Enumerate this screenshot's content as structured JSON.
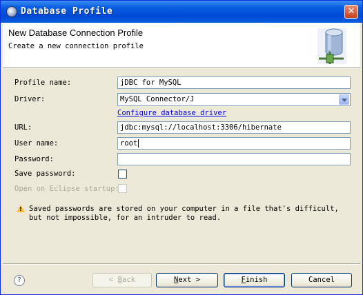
{
  "window": {
    "title": "Database Profile"
  },
  "header": {
    "title": "New Database Connection Profile",
    "description": "Create a new connection profile"
  },
  "form": {
    "profile_name": {
      "label": "Profile name:",
      "value": "jDBC for MySQL"
    },
    "driver": {
      "label": "Driver:",
      "value": "MySQL Connector/J"
    },
    "configure_link": "Configure database driver",
    "url": {
      "label": "URL:",
      "value": "jdbc:mysql://localhost:3306/hibernate"
    },
    "user_name": {
      "label": "User name:",
      "value": "root"
    },
    "password": {
      "label": "Password:",
      "value": ""
    },
    "save_password": {
      "label": "Save password:",
      "checked": false
    },
    "open_on_startup": {
      "label": "Open on Eclipse startup:",
      "checked": false,
      "enabled": false
    }
  },
  "warning": {
    "icon": "warning-icon",
    "text": "Saved passwords are stored on your computer in a file that's difficult, but not impossible, for an intruder to read."
  },
  "buttons": {
    "back": {
      "pre": "< ",
      "mnemonic": "B",
      "post": "ack"
    },
    "next": {
      "mnemonic": "N",
      "post": "ext >"
    },
    "finish": {
      "mnemonic": "F",
      "post": "inish"
    },
    "cancel": "Cancel"
  },
  "colors": {
    "titlebar": "#0a5ee0",
    "dialog_bg": "#ece9d8",
    "link": "#0000ee",
    "warning": "#f6c23e"
  }
}
